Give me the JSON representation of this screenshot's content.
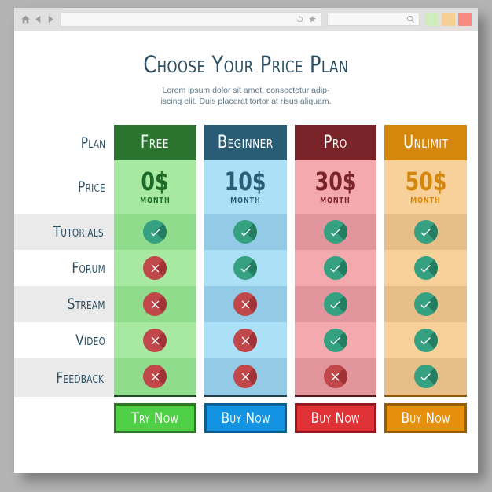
{
  "browser": {
    "icons": [
      "home-icon",
      "back-icon",
      "forward-icon",
      "reload-icon",
      "bookmark-star-icon",
      "search-icon"
    ],
    "url_value": "",
    "url_placeholder": "",
    "search_value": "",
    "search_placeholder": "",
    "window_buttons": [
      {
        "name": "minimize",
        "color": "#cdeeb8"
      },
      {
        "name": "maximize",
        "color": "#f7cf94"
      },
      {
        "name": "close",
        "color": "#f98a82"
      }
    ]
  },
  "page": {
    "title": "Choose Your Price Plan",
    "subtitle_line1": "Lorem ipsum dolor sit amet, consectetur adip-",
    "subtitle_line2": "iscing elit. Duis placerat tortor at risus aliquam."
  },
  "table": {
    "row_labels": {
      "plan": "Plan",
      "price": "Price",
      "features": [
        "Tutorials",
        "Forum",
        "Stream",
        "Video",
        "Feedback"
      ]
    },
    "columns": [
      {
        "name": "Free",
        "price": "0$",
        "period": "MONTH",
        "cta": "Try Now",
        "header_bg": "#2b7430",
        "body_bg_a": "#a7e9a0",
        "body_bg_b": "#8fdd8c",
        "price_bg": "#a7e9a0",
        "price_color": "#1d6b28",
        "foot_color": "#1e4f21",
        "btn_bg": "#4fcf45",
        "btn_border": "#2a7a22",
        "features": [
          "yes",
          "no",
          "no",
          "no",
          "no"
        ]
      },
      {
        "name": "Beginner",
        "price": "10$",
        "period": "MONTH",
        "cta": "Buy Now",
        "header_bg": "#2b5c75",
        "body_bg_a": "#ace0f7",
        "body_bg_b": "#93cbe7",
        "price_bg": "#ace0f7",
        "price_color": "#2b5c75",
        "foot_color": "#1e3f52",
        "btn_bg": "#1294e2",
        "btn_border": "#0c5f93",
        "features": [
          "yes",
          "yes",
          "no",
          "no",
          "no"
        ]
      },
      {
        "name": "Pro",
        "price": "30$",
        "period": "MONTH",
        "cta": "Buy Now",
        "header_bg": "#7a2328",
        "body_bg_a": "#f4a9ae",
        "body_bg_b": "#e2959c",
        "price_bg": "#f4a9ae",
        "price_color": "#7a2328",
        "foot_color": "#5a161b",
        "btn_bg": "#e03236",
        "btn_border": "#97191d",
        "features": [
          "yes",
          "yes",
          "yes",
          "yes",
          "no"
        ]
      },
      {
        "name": "Unlimit",
        "price": "50$",
        "period": "MONTH",
        "cta": "Buy Now",
        "header_bg": "#d5870d",
        "body_bg_a": "#f8d09a",
        "body_bg_b": "#e7bd88",
        "price_bg": "#f8d09a",
        "price_color": "#d5870d",
        "foot_color": "#93590a",
        "btn_bg": "#e4900e",
        "btn_border": "#9a5d06",
        "features": [
          "yes",
          "yes",
          "yes",
          "yes",
          "yes"
        ]
      }
    ]
  },
  "colors": {
    "page_bg": "#b3b3b3",
    "window_bg": "#ffffff",
    "toolbar_bg": "#e0e0e0",
    "heading": "#2d4f63",
    "row_shade": "#eaeaea",
    "check_circle": "#36a180",
    "cross_circle": "#c0484a"
  }
}
